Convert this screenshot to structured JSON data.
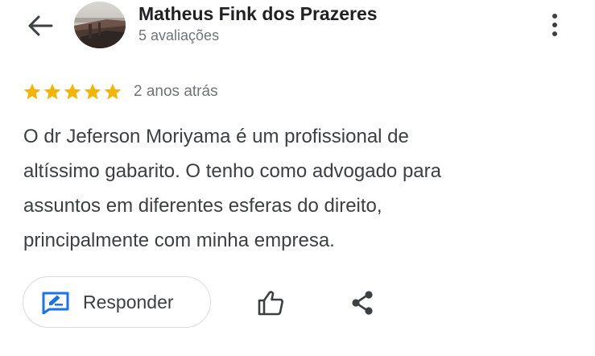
{
  "header": {
    "author_name": "Matheus Fink dos Prazeres",
    "author_reviews": "5 avaliações",
    "icons": {
      "back": "arrow-back-icon",
      "overflow": "more-vert-icon"
    }
  },
  "review": {
    "rating": 5,
    "rating_max": 5,
    "star_color": "#F4B400",
    "date": "2 anos atrás",
    "text": "O dr Jeferson Moriyama é um profissional de\naltíssimo gabarito. O tenho como advogado para\nassuntos em diferentes esferas do direito,\nprincipalmente com minha empresa."
  },
  "actions": {
    "reply_label": "Responder",
    "accent_color": "#1A73E8",
    "icons": {
      "reply": "reply-edit-icon",
      "like": "thumb-up-icon",
      "share": "share-icon"
    }
  }
}
